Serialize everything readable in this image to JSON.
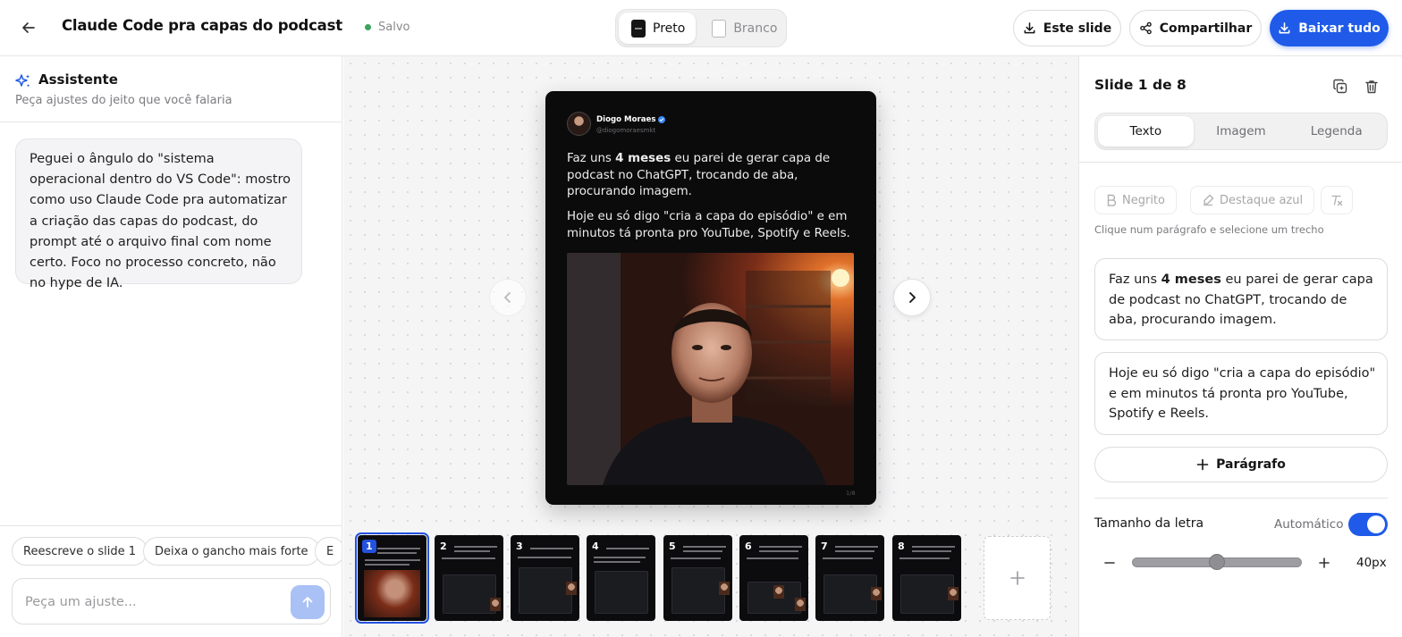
{
  "header": {
    "title": "Claude Code pra capas do podcast",
    "status": "Salvo",
    "theme_options": [
      {
        "label": "Preto",
        "active": true
      },
      {
        "label": "Branco",
        "active": false
      }
    ],
    "this_slide_label": "Este slide",
    "share_label": "Compartilhar",
    "download_all_label": "Baixar tudo"
  },
  "assistant": {
    "title": "Assistente",
    "subtitle": "Peça ajustes do jeito que você falaria",
    "message": "Peguei o ângulo do \"sistema operacional dentro do VS Code\": mostro como uso Claude Code pra automatizar a criação das capas do podcast, do prompt até o arquivo final com nome certo. Foco no processo concreto, não no hype de IA.",
    "chips": [
      "Reescreve o slide 1",
      "Deixa o gancho mais forte",
      "E"
    ],
    "input_placeholder": "Peça um ajuste..."
  },
  "slide": {
    "author_name": "Diogo Moraes",
    "author_handle": "@diogomoraesmkt",
    "p1_before": "Faz uns ",
    "p1_bold": "4 meses",
    "p1_after": " eu parei de gerar capa de podcast no ChatGPT, trocando de aba, procurando imagem.",
    "p2": "Hoje eu só digo \"cria a capa do episódio\" e em minutos tá pronta pro YouTube, Spotify e Reels.",
    "counter": "1/8"
  },
  "thumbnails": [
    {
      "num": "1",
      "active": true
    },
    {
      "num": "2",
      "active": false
    },
    {
      "num": "3",
      "active": false
    },
    {
      "num": "4",
      "active": false
    },
    {
      "num": "5",
      "active": false
    },
    {
      "num": "6",
      "active": false
    },
    {
      "num": "7",
      "active": false
    },
    {
      "num": "8",
      "active": false
    }
  ],
  "inspector": {
    "title": "Slide 1 de 8",
    "tabs": [
      "Texto",
      "Imagem",
      "Legenda"
    ],
    "active_tab": "Texto",
    "bold_label": "Negrito",
    "highlight_label": "Destaque azul",
    "hint": "Clique num parágrafo e selecione um trecho",
    "paragraph1_before": "Faz uns ",
    "paragraph1_bold": "4 meses",
    "paragraph1_after": " eu parei de gerar capa de podcast no ChatGPT, trocando de aba, procurando imagem.",
    "paragraph2": "Hoje eu só digo \"cria a capa do episódio\" e em minutos tá pronta pro YouTube, Spotify e Reels.",
    "add_paragraph_label": "Parágrafo",
    "font_size_label": "Tamanho da letra",
    "auto_label": "Automático",
    "auto_enabled": true,
    "font_size_value": "40px",
    "font_size_slider_fraction": 0.5
  },
  "colors": {
    "accent": "#1f5be8",
    "saved_dot": "#3aa55d",
    "slide_bg": "#0b0b0c"
  }
}
